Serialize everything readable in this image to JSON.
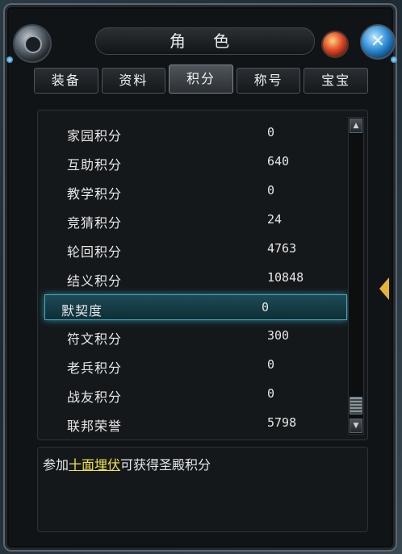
{
  "window": {
    "title": "角 色"
  },
  "tabs": [
    {
      "label": "装备",
      "active": false
    },
    {
      "label": "资料",
      "active": false
    },
    {
      "label": "积分",
      "active": true
    },
    {
      "label": "称号",
      "active": false
    },
    {
      "label": "宝宝",
      "active": false
    }
  ],
  "points": [
    {
      "label": "家园积分",
      "value": "0"
    },
    {
      "label": "互助积分",
      "value": "640"
    },
    {
      "label": "教学积分",
      "value": "0"
    },
    {
      "label": "竞猜积分",
      "value": "24"
    },
    {
      "label": "轮回积分",
      "value": "4763"
    },
    {
      "label": "结义积分",
      "value": "10848"
    },
    {
      "label": "默契度",
      "value": "0",
      "selected": true
    },
    {
      "label": "符文积分",
      "value": "300"
    },
    {
      "label": "老兵积分",
      "value": "0"
    },
    {
      "label": "战友积分",
      "value": "0"
    },
    {
      "label": "联邦荣誉",
      "value": "5798"
    }
  ],
  "description": {
    "prefix": "参加",
    "link": "十面埋伏",
    "suffix": "可获得圣殿积分"
  },
  "colors": {
    "selected_row": "#1d4b56",
    "link_text": "#f0e34a",
    "orb_blue": "#2f8fd6"
  },
  "icons": {
    "close": "close-icon",
    "menu": "emblem-icon",
    "scroll_up": "arrow-up-icon",
    "scroll_down": "arrow-down-icon"
  }
}
